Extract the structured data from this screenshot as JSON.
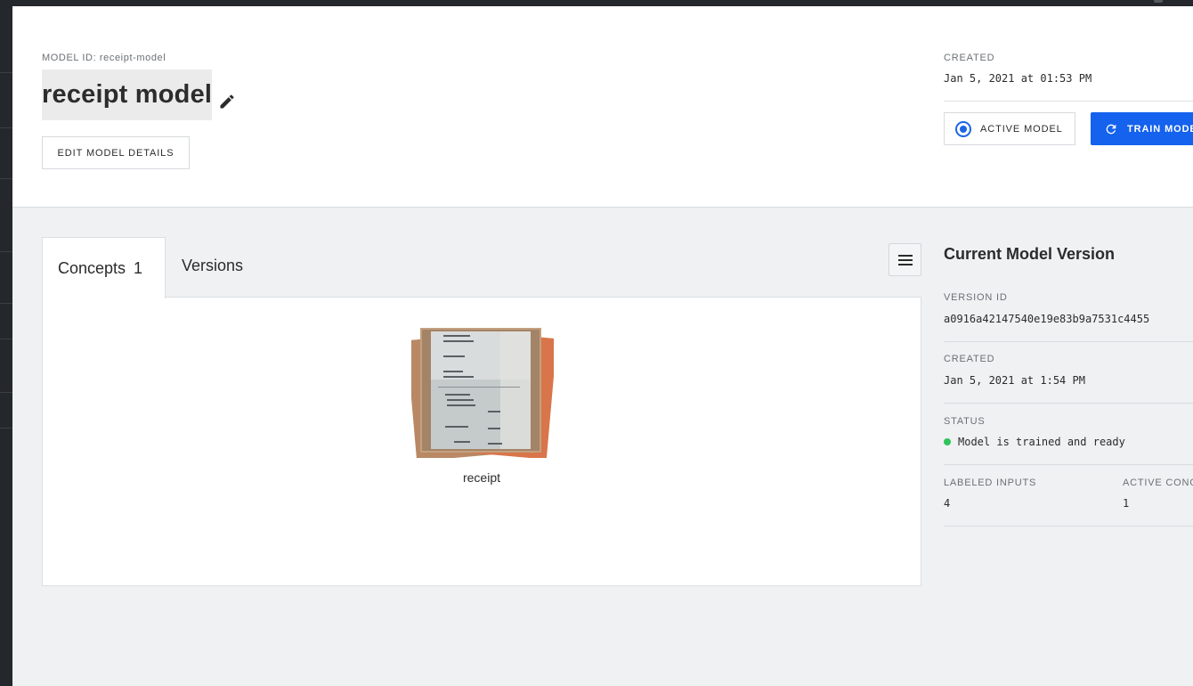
{
  "header": {
    "model_id_label": "MODEL ID: receipt-model",
    "model_name": "receipt model",
    "edit_details_label": "EDIT MODEL DETAILS",
    "created_label": "CREATED",
    "created_value": "Jan 5, 2021 at 01:53 PM",
    "active_model_label": "ACTIVE MODEL",
    "train_model_label": "TRAIN MODEL"
  },
  "tabs": {
    "concepts_label": "Concepts",
    "concepts_count": "1",
    "versions_label": "Versions"
  },
  "concepts": [
    {
      "label": "receipt"
    }
  ],
  "version": {
    "title": "Current Model Version",
    "version_id_label": "VERSION ID",
    "version_id_value": "a0916a42147540e19e83b9a7531c4455",
    "created_label": "CREATED",
    "created_value": "Jan 5, 2021 at 1:54 PM",
    "status_label": "STATUS",
    "status_value": "Model is trained and ready",
    "labeled_inputs_label": "LABELED INPUTS",
    "labeled_inputs_value": "4",
    "active_concepts_label": "ACTIVE CONCEPTS",
    "active_concepts_value": "1"
  },
  "colors": {
    "accent": "#1462ed",
    "status_ok": "#2ec45a"
  },
  "icons": {
    "edit": "pencil-icon",
    "active": "radio-selected-icon",
    "train": "refresh-icon",
    "menu": "hamburger-menu-icon"
  }
}
